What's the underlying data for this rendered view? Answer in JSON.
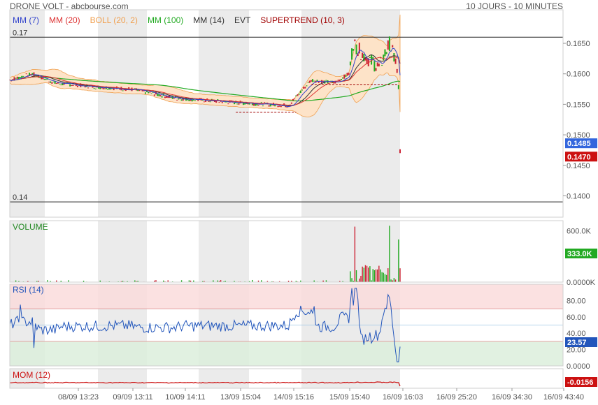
{
  "header": {
    "title": "DRONE VOLT - abcbourse.com",
    "period": "10 JOURS - 10 MINUTES"
  },
  "legend": [
    {
      "label": "MM (7)",
      "color": "#3344cc"
    },
    {
      "label": "MM (20)",
      "color": "#dd3333"
    },
    {
      "label": "BOLL (20, 2)",
      "color": "#f0a050"
    },
    {
      "label": "MM (100)",
      "color": "#22aa22"
    },
    {
      "label": "MM (14)",
      "color": "#333333"
    },
    {
      "label": "EVT",
      "color": "#333333"
    },
    {
      "label": "SUPERTREND (10, 3)",
      "color": "#a00000"
    }
  ],
  "colors": {
    "up": "#22aa22",
    "down": "#cc2233",
    "boll_fill": "#fde3c8",
    "boll_line": "#f0a050",
    "shade": "#ebebeb",
    "rsi_high": "#fadcdc",
    "rsi_low": "#dcefdc",
    "last_price": "#3366dd",
    "prev_price": "#cc1111",
    "volume_badge": "#22aa22",
    "rsi_badge": "#2255bb",
    "mom_badge": "#cc1111"
  },
  "price_panel": {
    "y_ticks": [
      "0.1650",
      "0.1600",
      "0.1550",
      "0.1500",
      "0.1450",
      "0.1400"
    ],
    "ylim": [
      0.1365,
      0.1705
    ],
    "h_lines": [
      {
        "label": "0.17",
        "value": 0.166
      },
      {
        "label": "0.14",
        "value": 0.139
      }
    ],
    "last_price": "0.1485",
    "prev_price": "0.1470"
  },
  "volume_panel": {
    "label": "VOLUME",
    "y_ticks": [
      "600.0K",
      "0.0000K"
    ],
    "ylim": [
      0,
      720000
    ],
    "last_value": "333.0K"
  },
  "rsi_panel": {
    "label": "RSI (14)",
    "y_ticks": [
      "80.00",
      "60.00",
      "40.00",
      "20.00"
    ],
    "ylim": [
      0,
      100
    ],
    "overbought": 70,
    "oversold": 30,
    "last_value": "23.57"
  },
  "mom_panel": {
    "label": "MOM (12)",
    "last_value": "-0.0156"
  },
  "x_axis": {
    "ticks": [
      "08/09 13:23",
      "09/09 13:11",
      "10/09 14:11",
      "13/09 15:04",
      "14/09 15:16",
      "15/09 15:40",
      "16/09 16:03",
      "16/09 25:20",
      "16/09 34:30",
      "16/09 43:40"
    ]
  },
  "chart_data": {
    "type": "line",
    "x": [
      "08/09 13:23",
      "09/09 13:11",
      "10/09 14:11",
      "13/09 15:04",
      "14/09 15:16",
      "15/09 15:40",
      "16/09 16:03"
    ],
    "series": [
      {
        "name": "MM (7)",
        "values": [
          0.159,
          0.1582,
          0.1566,
          0.1553,
          0.1548,
          0.1588,
          0.16
        ]
      },
      {
        "name": "MM (20)",
        "values": [
          0.159,
          0.1583,
          0.157,
          0.1555,
          0.155,
          0.1582,
          0.161
        ]
      },
      {
        "name": "MM (100)",
        "values": [
          0.1588,
          0.1582,
          0.157,
          0.1558,
          0.1552,
          0.1565,
          0.1598
        ]
      }
    ],
    "last_close": 0.147,
    "rsi_last": 23.57,
    "mom_last": -0.0156
  }
}
